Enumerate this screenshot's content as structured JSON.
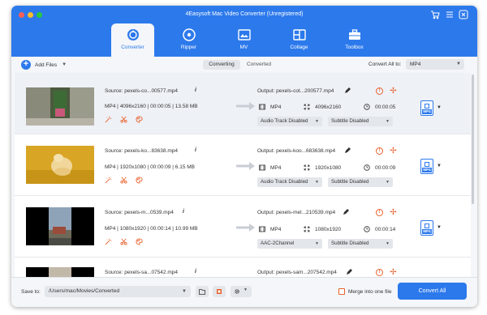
{
  "app": {
    "title": "4Easysoft Mac Video Converter (Unregistered)"
  },
  "colors": {
    "accent": "#2c79ec",
    "warning": "#e8612c"
  },
  "nav": {
    "tabs": [
      {
        "label": "Converter",
        "icon": "converter-icon",
        "active": true
      },
      {
        "label": "Ripper",
        "icon": "ripper-disc-icon",
        "active": false
      },
      {
        "label": "MV",
        "icon": "mv-image-icon",
        "active": false
      },
      {
        "label": "Collage",
        "icon": "collage-grid-icon",
        "active": false
      },
      {
        "label": "Toolbox",
        "icon": "toolbox-icon",
        "active": false
      }
    ]
  },
  "toolbar": {
    "add_files": "Add Files",
    "tab_converting": "Converting",
    "tab_converted": "Converted",
    "convert_all_to_label": "Convert All to:",
    "convert_all_format": "MP4"
  },
  "files": [
    {
      "source": "Source: pexels-co...00577.mp4",
      "format": "MP4",
      "resolution": "4096x2160",
      "duration": "00:00:05",
      "size": "13.58 MB",
      "output": "Output: pexels-cot...200577.mp4",
      "out_format": "MP4",
      "out_resolution": "4096x2160",
      "out_duration": "00:00:05",
      "audio": "Audio Track Disabled",
      "subtitle": "Subtitle Disabled",
      "badge": "MP4"
    },
    {
      "source": "Source: pexels-ko...83638.mp4",
      "format": "MP4",
      "resolution": "1920x1080",
      "duration": "00:00:09",
      "size": "6.15 MB",
      "output": "Output: pexels-koo...683638.mp4",
      "out_format": "MP4",
      "out_resolution": "1920x1080",
      "out_duration": "00:00:09",
      "audio": "Audio Track Disabled",
      "subtitle": "Subtitle Disabled",
      "badge": "MP4"
    },
    {
      "source": "Source: pexels-m...0539.mp4",
      "format": "MP4",
      "resolution": "1080x1920",
      "duration": "00:00:14",
      "size": "10.99 MB",
      "output": "Output: pexels-mel...210539.mp4",
      "out_format": "MP4",
      "out_resolution": "1080x1920",
      "out_duration": "00:00:14",
      "audio": "AAC-2Channel",
      "subtitle": "Subtitle Disabled",
      "badge": "MP4"
    },
    {
      "source": "Source: pexels-sa...07542.mp4",
      "output": "Output: pexels-sam...207542.mp4"
    }
  ],
  "footer": {
    "save_to_label": "Save to:",
    "save_path": "/Users/mac/Movies/Converted",
    "merge_label": "Merge into one file",
    "convert_all_button": "Convert All"
  }
}
